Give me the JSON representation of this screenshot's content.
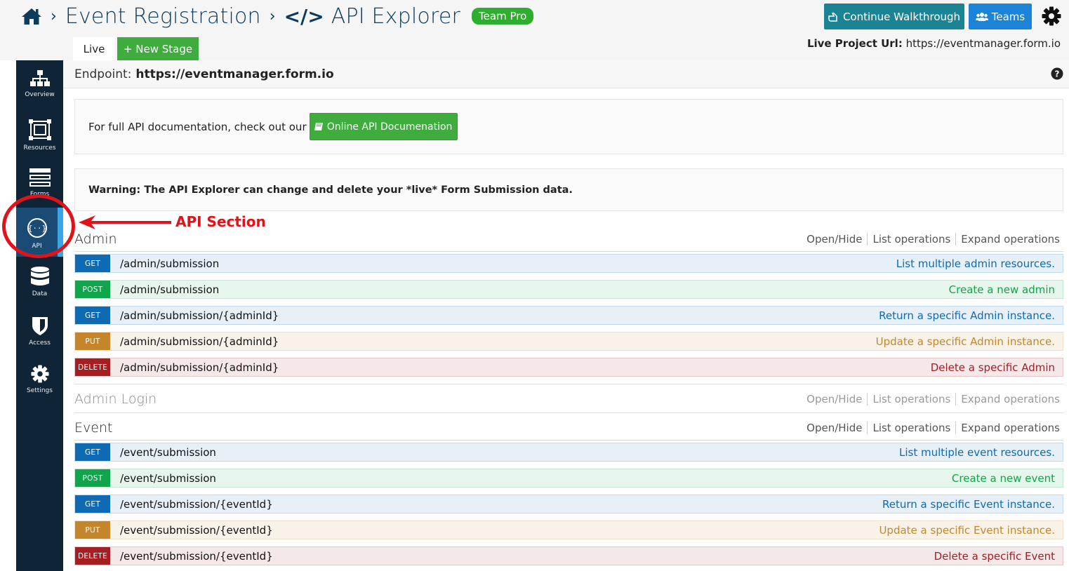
{
  "header": {
    "breadcrumb_sep1": "›",
    "project_title": "Event Registration",
    "breadcrumb_sep2": "›",
    "code_glyph": "</>",
    "page_title": "API Explorer",
    "plan_badge": "Team Pro",
    "walkthrough_label": "Continue Walkthrough",
    "teams_label": "Teams",
    "home_icon": "home-icon",
    "settings_icon": "gear-icon"
  },
  "stages": {
    "live_tab": "Live",
    "new_stage": "+ New Stage",
    "live_url_label": "Live Project Url:",
    "live_url_value": "https://eventmanager.form.io"
  },
  "sidebar": {
    "items": [
      {
        "label": "Overview",
        "icon": "sitemap-icon"
      },
      {
        "label": "Resources",
        "icon": "resources-icon"
      },
      {
        "label": "Forms",
        "icon": "forms-icon"
      },
      {
        "label": "API",
        "icon": "api-icon",
        "active": true
      },
      {
        "label": "Data",
        "icon": "database-icon"
      },
      {
        "label": "Access",
        "icon": "shield-icon"
      },
      {
        "label": "Settings",
        "icon": "gear-icon"
      }
    ]
  },
  "endpoint": {
    "label": "Endpoint:",
    "value": "https://eventmanager.form.io"
  },
  "docs": {
    "text": "For full API documentation, check out our",
    "button": "Online API Documenation"
  },
  "warning": "Warning: The API Explorer can change and delete your *live* Form Submission data.",
  "annotation": {
    "label": "API Section",
    "color": "#e0121a"
  },
  "group_ops": {
    "open_hide": "Open/Hide",
    "list": "List operations",
    "expand": "Expand operations"
  },
  "groups": [
    {
      "name": "Admin",
      "operations": [
        {
          "method": "GET",
          "path": "/admin/submission",
          "desc": "List multiple admin resources."
        },
        {
          "method": "POST",
          "path": "/admin/submission",
          "desc": "Create a new admin"
        },
        {
          "method": "GET",
          "path": "/admin/submission/{adminId}",
          "desc": "Return a specific Admin instance."
        },
        {
          "method": "PUT",
          "path": "/admin/submission/{adminId}",
          "desc": "Update a specific Admin instance."
        },
        {
          "method": "DELETE",
          "path": "/admin/submission/{adminId}",
          "desc": "Delete a specific Admin"
        }
      ]
    },
    {
      "name": "Admin Login",
      "operations": []
    },
    {
      "name": "Event",
      "operations": [
        {
          "method": "GET",
          "path": "/event/submission",
          "desc": "List multiple event resources."
        },
        {
          "method": "POST",
          "path": "/event/submission",
          "desc": "Create a new event"
        },
        {
          "method": "GET",
          "path": "/event/submission/{eventId}",
          "desc": "Return a specific Event instance."
        },
        {
          "method": "PUT",
          "path": "/event/submission/{eventId}",
          "desc": "Update a specific Event instance."
        },
        {
          "method": "DELETE",
          "path": "/event/submission/{eventId}",
          "desc": "Delete a specific Event"
        }
      ]
    }
  ],
  "colors": {
    "sidebar_bg": "#0f2537",
    "sidebar_active": "#1a4b75",
    "brand_green": "#3ead3e",
    "get": "#0f6ab4",
    "post": "#10a54a",
    "put": "#c5862b",
    "delete": "#a41e22"
  }
}
